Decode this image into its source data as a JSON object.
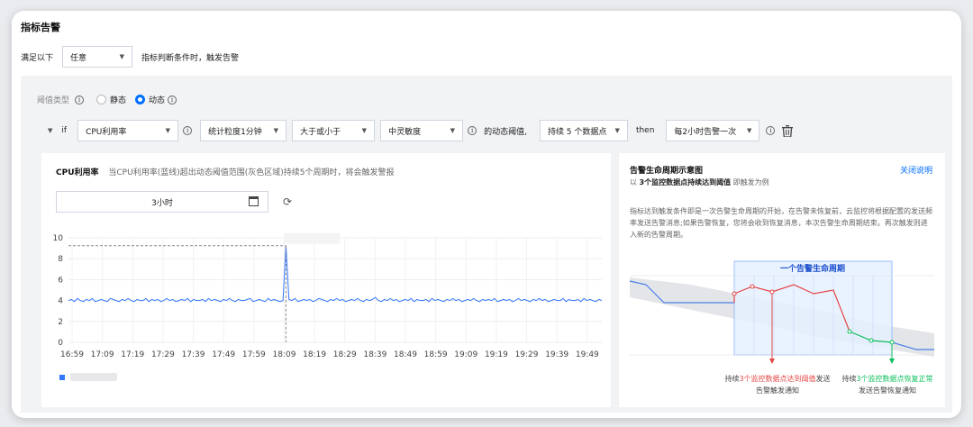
{
  "section_title": "指标告警",
  "condition": {
    "prefix": "满足以下",
    "mode": "任意",
    "suffix": "指标判断条件时，触发告警"
  },
  "threshold": {
    "label": "阈值类型",
    "option_static": "静态",
    "option_dynamic": "动态",
    "selected": "动态"
  },
  "rule": {
    "if_label": "if",
    "metric": "CPU利用率",
    "granularity": "统计粒度1分钟",
    "comparison": "大于或小于",
    "sensitivity": "中灵敏度",
    "dynamic_label": "的动态阈值,",
    "duration": "持续 5 个数据点",
    "then_label": "then",
    "frequency": "每2小时告警一次"
  },
  "chart_card": {
    "title": "CPU利用率",
    "description": "当CPU利用率(蓝线)超出动态阈值范围(灰色区域)持续5个周期时，将会触发警报",
    "time_range": "3小时"
  },
  "chart_data": {
    "type": "line",
    "title": "",
    "xlabel": "",
    "ylabel": "",
    "ylim": [
      0,
      10
    ],
    "yticks": [
      0,
      2,
      4,
      6,
      8,
      10
    ],
    "xticks": [
      "16:59",
      "17:09",
      "17:19",
      "17:29",
      "17:39",
      "17:49",
      "17:59",
      "18:09",
      "18:19",
      "18:29",
      "18:39",
      "18:49",
      "18:59",
      "19:09",
      "19:19",
      "19:29",
      "19:39",
      "19:49"
    ],
    "grid": true,
    "highlight": {
      "x_index": 73,
      "y": 9.25
    },
    "series": [
      {
        "color": "#3377ff",
        "values": [
          4.0,
          4.1,
          3.9,
          4.2,
          4.0,
          3.9,
          4.1,
          4.0,
          4.2,
          3.9,
          4.0,
          4.1,
          4.0,
          3.9,
          4.2,
          4.1,
          4.0,
          3.9,
          4.1,
          4.0,
          4.2,
          4.0,
          3.9,
          4.1,
          4.0,
          4.0,
          4.2,
          3.9,
          4.1,
          4.0,
          4.1,
          3.9,
          4.0,
          4.2,
          4.0,
          4.1,
          3.9,
          4.0,
          4.1,
          4.0,
          4.2,
          3.9,
          4.1,
          4.0,
          4.0,
          4.1,
          3.9,
          4.2,
          4.0,
          4.1,
          4.0,
          3.9,
          4.1,
          4.0,
          4.2,
          4.0,
          3.9,
          4.1,
          4.0,
          4.0,
          4.1,
          4.2,
          3.9,
          4.0,
          4.1,
          4.0,
          3.9,
          4.2,
          4.0,
          4.1,
          4.0,
          3.9,
          4.0,
          9.25,
          4.1,
          4.0,
          4.2,
          3.9,
          4.0,
          4.1,
          4.0,
          4.1,
          3.9,
          4.0,
          4.2,
          4.1,
          4.0,
          3.9,
          4.1,
          4.0,
          4.2,
          4.0,
          4.1,
          3.9,
          4.0,
          4.1,
          4.0,
          4.2,
          4.0,
          3.9,
          4.1,
          4.0,
          4.1,
          4.3,
          4.0,
          3.9,
          4.1,
          4.0,
          4.2,
          4.0,
          4.1,
          3.9,
          4.0,
          4.1,
          4.0,
          4.2,
          3.9,
          4.1,
          4.0,
          4.0,
          4.1,
          3.9,
          4.2,
          4.0,
          4.1,
          4.0,
          3.9,
          4.1,
          4.0,
          4.2,
          4.0,
          4.1,
          3.9,
          4.0,
          4.1,
          4.0,
          4.2,
          4.0,
          3.9,
          4.1,
          4.0,
          4.1,
          4.0,
          4.2,
          3.9,
          4.0,
          4.1,
          4.0,
          4.1,
          3.9,
          4.0,
          4.2,
          4.0,
          4.1,
          4.0,
          3.9,
          4.1,
          4.0,
          4.2,
          4.0,
          4.1,
          3.9,
          4.0,
          4.1,
          4.0,
          4.0,
          4.2,
          3.9,
          4.1,
          4.0,
          4.0,
          4.1,
          3.9,
          4.2,
          4.0,
          4.1,
          4.0,
          3.9,
          4.1,
          4.0
        ]
      }
    ]
  },
  "diagram": {
    "title": "告警生命周期示意图",
    "subtitle_prefix": "以",
    "subtitle_bold": "3个监控数据点持续达到阈值",
    "subtitle_suffix": "即触发为例",
    "close_link": "关闭说明",
    "description": "指标达到触发条件即是一次告警生命周期的开始，在告警未恢复前，云监控将根据配置的发送频率发送告警消息;如果告警恢复，您将会收到恢复消息，本次告警生命周期结束。再次触发则进入新的告警周期。",
    "cycle_label": "一个告警生命周期",
    "left_caption_pre": "持续",
    "left_caption_em": "3个监控数据点达到阈值",
    "left_caption_post": "发送",
    "left_caption_line2": "告警触发通知",
    "right_caption_pre": "持续",
    "right_caption_em": "3个监控数据点恢复正常",
    "right_caption_line2": "发送告警恢复通知"
  },
  "icons": {
    "info": "info-circle-icon",
    "calendar": "calendar-icon",
    "refresh": "refresh-icon",
    "delete": "trash-icon"
  }
}
